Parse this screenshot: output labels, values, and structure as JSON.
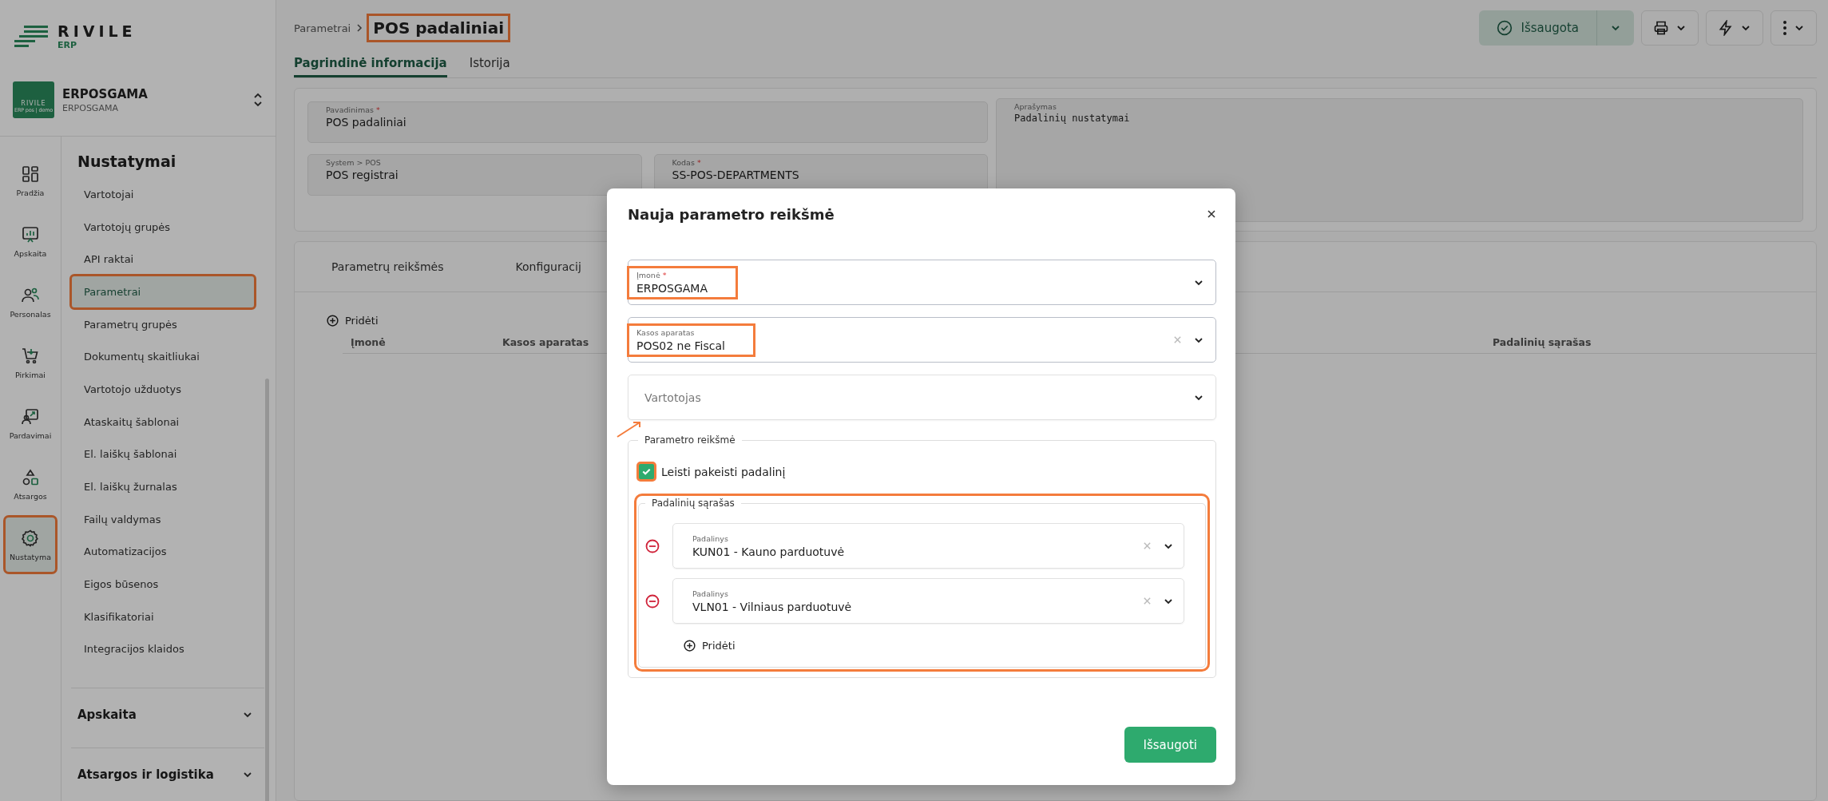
{
  "brand": {
    "name": "RIVILE",
    "sub": "ERP"
  },
  "company": {
    "name": "ERPOSGAMA",
    "sub": "ERPOSGAMA",
    "badge": "RIVILE",
    "badge_sub": "ERP pos | demo"
  },
  "rail": [
    {
      "label": "Pradžia",
      "kind": "dashboard",
      "selected": false,
      "highlighted": false
    },
    {
      "label": "Apskaita",
      "kind": "chart",
      "selected": false,
      "highlighted": false
    },
    {
      "label": "Personalas",
      "kind": "people",
      "selected": false,
      "highlighted": false
    },
    {
      "label": "Pirkimai",
      "kind": "cart",
      "selected": false,
      "highlighted": false
    },
    {
      "label": "Pardavimai",
      "kind": "sales",
      "selected": false,
      "highlighted": false
    },
    {
      "label": "Atsargos",
      "kind": "shapes",
      "selected": false,
      "highlighted": false
    },
    {
      "label": "Nustatyma",
      "kind": "gear",
      "selected": true,
      "highlighted": true
    }
  ],
  "nav": {
    "title": "Nustatymai",
    "items": [
      {
        "label": "Vartotojai",
        "selected": false,
        "highlighted": false
      },
      {
        "label": "Vartotojų grupės",
        "selected": false,
        "highlighted": false
      },
      {
        "label": "API raktai",
        "selected": false,
        "highlighted": false
      },
      {
        "label": "Parametrai",
        "selected": true,
        "highlighted": true
      },
      {
        "label": "Parametrų grupės",
        "selected": false,
        "highlighted": false
      },
      {
        "label": "Dokumentų skaitliukai",
        "selected": false,
        "highlighted": false
      },
      {
        "label": "Vartotojo užduotys",
        "selected": false,
        "highlighted": false
      },
      {
        "label": "Ataskaitų šablonai",
        "selected": false,
        "highlighted": false
      },
      {
        "label": "El. laiškų šablonai",
        "selected": false,
        "highlighted": false
      },
      {
        "label": "El. laiškų žurnalas",
        "selected": false,
        "highlighted": false
      },
      {
        "label": "Failų valdymas",
        "selected": false,
        "highlighted": false
      },
      {
        "label": "Automatizacijos",
        "selected": false,
        "highlighted": false
      },
      {
        "label": "Eigos būsenos",
        "selected": false,
        "highlighted": false
      },
      {
        "label": "Klasifikatoriai",
        "selected": false,
        "highlighted": false
      },
      {
        "label": "Integracijos klaidos",
        "selected": false,
        "highlighted": false
      }
    ],
    "sections": [
      {
        "label": "Apskaita",
        "expanded": false
      },
      {
        "label": "Atsargos ir logistika",
        "expanded": false
      }
    ]
  },
  "breadcrumb": {
    "parent": "Parametrai",
    "current": "POS padaliniai",
    "highlighted": true
  },
  "toolbar": {
    "status": "Išsaugota",
    "buttons": [
      {
        "kind": "printer"
      },
      {
        "kind": "bolt"
      },
      {
        "kind": "more"
      }
    ]
  },
  "tabs": [
    {
      "label": "Pagrindinė informacija",
      "selected": true
    },
    {
      "label": "Istorija",
      "selected": false
    }
  ],
  "form": {
    "name": {
      "label": "Pavadinimas",
      "required_mark": "*",
      "value": "POS padaliniai"
    },
    "group": {
      "label": "System > POS",
      "value": "POS registrai"
    },
    "code": {
      "label": "Kodas",
      "required_mark": "*",
      "value": "SS-POS-DEPARTMENTS"
    },
    "description": {
      "label": "Aprašymas",
      "value": "Padalinių nustatymai"
    }
  },
  "values_panel": {
    "tabs": [
      {
        "label": "Parametrų reikšmės",
        "selected": false
      },
      {
        "label": "Konfiguracij",
        "selected": false
      }
    ],
    "add_label": "Pridėti",
    "columns": [
      "Įmonė",
      "Kasos aparatas",
      "Padalinių sąrašas"
    ]
  },
  "modal": {
    "title": "Nauja parametro reikšmė",
    "fields": [
      {
        "label": "Įmonė",
        "required_mark": "*",
        "value": "ERPOSGAMA",
        "clearable": false,
        "highlighted": true
      },
      {
        "label": "Kasos aparatas",
        "value": "POS02 ne Fiscal",
        "clearable": true,
        "highlighted": true
      }
    ],
    "user_field": {
      "placeholder": "Vartotojas",
      "arrow": true
    },
    "group": {
      "legend": "Parametro reikšmė",
      "checkbox": {
        "label": "Leisti pakeisti padalinį",
        "checked": true,
        "highlighted": true
      },
      "list": {
        "legend": "Padalinių sąrašas",
        "highlighted": true,
        "add_label": "Pridėti",
        "items": [
          {
            "label": "Padalinys",
            "value": "KUN01 - Kauno parduotuvė"
          },
          {
            "label": "Padalinys",
            "value": "VLN01 - Vilniaus parduotuvė"
          }
        ]
      }
    },
    "save": "Išsaugoti"
  }
}
